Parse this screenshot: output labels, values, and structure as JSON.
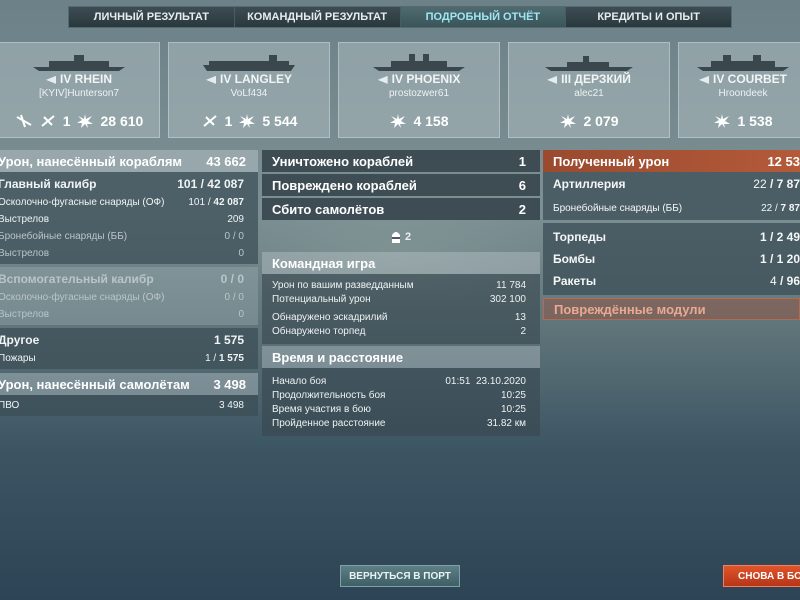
{
  "tabs": [
    "ЛИЧНЫЙ РЕЗУЛЬТАТ",
    "КОМАНДНЫЙ РЕЗУЛЬТАТ",
    "ПОДРОБНЫЙ ОТЧЁТ",
    "КРЕДИТЫ И ОПЫТ"
  ],
  "active_tab": 2,
  "ships": [
    {
      "name": "IV RHEIN",
      "player": "[KYIV]Hunterson7",
      "plane_kills": "1",
      "damage": "28 610"
    },
    {
      "name": "IV LANGLEY",
      "player": "VoLf434",
      "plane_kills": "1",
      "damage": "5 544"
    },
    {
      "name": "IV PHOENIX",
      "player": "prostozwer61",
      "damage": "4 158"
    },
    {
      "name": "III ДЕРЗКИЙ",
      "player": "alec21",
      "damage": "2 079"
    },
    {
      "name": "IV COURBET",
      "player": "Hroondeek",
      "damage": "1 538"
    }
  ],
  "left": {
    "ship_damage_label": "Урон, нанесённый кораблям",
    "ship_damage_value": "43 662",
    "main_battery_label": "Главный калибр",
    "main_battery_hits": "101",
    "main_battery_dmg": "42 087",
    "he_label": "Осколочно-фугасные снаряды (ОФ)",
    "he_hits": "101",
    "he_dmg": "42 087",
    "he_shots_label": "Выстрелов",
    "he_shots": "209",
    "ap_label": "Бронебойные снаряды (ББ)",
    "ap_val": "0 / 0",
    "ap_shots_label": "Выстрелов",
    "ap_shots": "0",
    "secondary_label": "Вспомогательный калибр",
    "secondary_val": "0 / 0",
    "sec_he_label": "Осколочно-фугасные снаряды (ОФ)",
    "sec_he_val": "0 / 0",
    "sec_shots_label": "Выстрелов",
    "sec_shots": "0",
    "other_label": "Другое",
    "other_val": "1 575",
    "fires_label": "Пожары",
    "fires_hits": "1",
    "fires_dmg": "1 575",
    "plane_damage_label": "Урон, нанесённый самолётам",
    "plane_damage_value": "3 498",
    "aa_label": "ПВО",
    "aa_val": "3 498"
  },
  "mid": {
    "destroyed_label": "Уничтожено кораблей",
    "destroyed_val": "1",
    "damaged_label": "Повреждено кораблей",
    "damaged_val": "6",
    "planes_label": "Сбито самолётов",
    "planes_val": "2",
    "planes_aa": "2",
    "team_title": "Командная игра",
    "spotting_label": "Урон по вашим разведданным",
    "spotting_val": "11 784",
    "potential_label": "Потенциальный урон",
    "potential_val": "302 100",
    "squad_label": "Обнаружено эскадрилий",
    "squad_val": "13",
    "torp_label": "Обнаружено торпед",
    "torp_val": "2",
    "time_title": "Время и расстояние",
    "start_label": "Начало боя",
    "start_val": "01:51  23.10.2020",
    "duration_label": "Продолжительность боя",
    "duration_val": "10:25",
    "participation_label": "Время участия в бою",
    "participation_val": "10:25",
    "distance_label": "Пройденное расстояние",
    "distance_val": "31.82 км"
  },
  "right": {
    "received_label": "Полученный урон",
    "received_val": "12 53",
    "artillery_label": "Артиллерия",
    "artillery_hits": "22",
    "artillery_dmg": "7 87",
    "ap_label": "Бронебойные снаряды (ББ)",
    "ap_hits": "22",
    "ap_dmg": "7 87",
    "torpedoes_label": "Торпеды",
    "torpedoes_hits": "1",
    "torpedoes_dmg": "2 49",
    "bombs_label": "Бомбы",
    "bombs_hits": "1",
    "bombs_dmg": "1 20",
    "rockets_label": "Ракеты",
    "rockets_hits": "4",
    "rockets_dmg": "96",
    "modules_label": "Повреждённые модули"
  },
  "buttons": {
    "port": "ВЕРНУТЬСЯ В ПОРТ",
    "battle": "СНОВА В БОЙ"
  }
}
